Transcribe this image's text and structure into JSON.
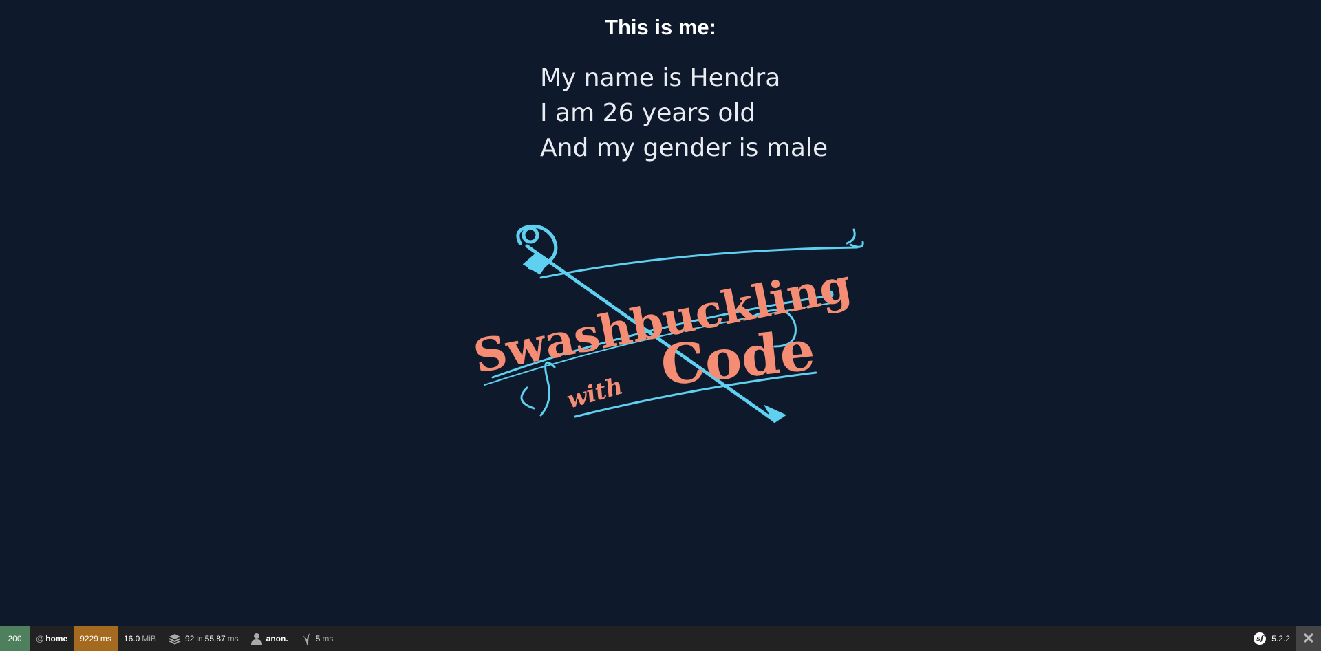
{
  "heading": "This is me:",
  "info": {
    "line1": "My name is Hendra",
    "line2": "I am 26 years old",
    "line3": "And my gender is male"
  },
  "logo": {
    "word_main": "Swashbuckling",
    "word_with": "with",
    "word_code": "Code",
    "colors": {
      "text": "#f48d73",
      "accent": "#5fd0f0"
    }
  },
  "toolbar": {
    "status_code": "200",
    "route_prefix": "@",
    "route": "home",
    "time_value": "9229",
    "time_unit": "ms",
    "memory_value": "16.0",
    "memory_unit": "MiB",
    "cache_count": "92",
    "cache_in": "in",
    "cache_time": "55.87",
    "cache_unit": "ms",
    "user": "anon.",
    "twig_time": "5",
    "twig_unit": "ms",
    "version": "5.2.2",
    "close_symbol": "✕",
    "sf_symbol": "sf"
  },
  "colors": {
    "background": "#0e192b",
    "toolbar_bg": "#222222",
    "status_ok": "#4f805d",
    "time_warning": "#a46a1f"
  }
}
